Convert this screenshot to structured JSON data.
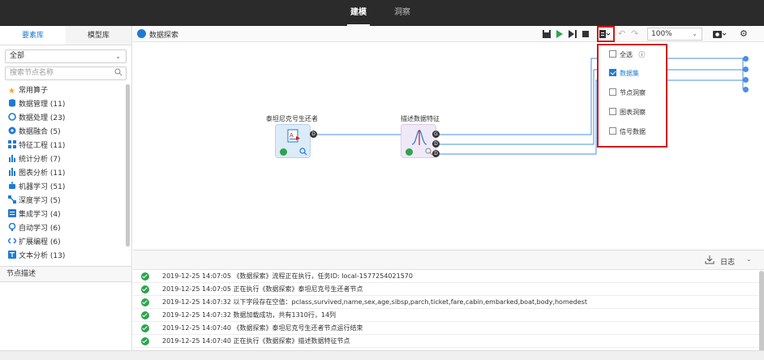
{
  "topbar": {
    "tabs": [
      {
        "label": "建模",
        "active": true
      },
      {
        "label": "洞察",
        "active": false
      }
    ]
  },
  "left": {
    "tabs": [
      {
        "label": "要素库",
        "active": true
      },
      {
        "label": "模型库",
        "active": false
      }
    ],
    "select_value": "全部",
    "search_placeholder": "搜索节点名称",
    "tree": [
      {
        "label": "常用算子",
        "icon": "star-icon",
        "color": "#f5a623"
      },
      {
        "label": "数据管理 (11)",
        "icon": "database-icon",
        "color": "#1f7ad3"
      },
      {
        "label": "数据处理 (23)",
        "icon": "cycle-icon",
        "color": "#1f7ad3"
      },
      {
        "label": "数据融合 (5)",
        "icon": "merge-icon",
        "color": "#1f7ad3"
      },
      {
        "label": "特征工程 (11)",
        "icon": "grid-icon",
        "color": "#1f7ad3"
      },
      {
        "label": "统计分析 (7)",
        "icon": "bar-icon",
        "color": "#1f7ad3"
      },
      {
        "label": "图表分析 (11)",
        "icon": "chart-icon",
        "color": "#1f7ad3"
      },
      {
        "label": "机器学习 (51)",
        "icon": "robot-icon",
        "color": "#1f7ad3"
      },
      {
        "label": "深度学习 (5)",
        "icon": "network-icon",
        "color": "#1f7ad3"
      },
      {
        "label": "集成学习 (4)",
        "icon": "ensemble-icon",
        "color": "#1f7ad3"
      },
      {
        "label": "自动学习 (6)",
        "icon": "auto-icon",
        "color": "#1f7ad3"
      },
      {
        "label": "扩展编程 (6)",
        "icon": "code-icon",
        "color": "#1f7ad3"
      },
      {
        "label": "文本分析 (13)",
        "icon": "text-icon",
        "color": "#1f7ad3"
      }
    ],
    "node_desc": "节点描述"
  },
  "header": {
    "title": "数据探索",
    "zoom": "100%"
  },
  "canvas": {
    "node1_label": "泰坦尼克号生还者",
    "node2_label": "描述数据特征",
    "port_d": "D",
    "port_g": "G"
  },
  "dropdown": {
    "items": [
      {
        "label": "全选",
        "checked": false,
        "info": "ⓘ"
      },
      {
        "label": "数据集",
        "checked": true
      },
      {
        "label": "节点洞察",
        "checked": false
      },
      {
        "label": "图表洞察",
        "checked": false
      },
      {
        "label": "信号数据",
        "checked": false
      }
    ]
  },
  "log": {
    "label": "日志",
    "rows": [
      "2019-12-25 14:07:05 《数据探索》流程正在执行，任务ID: local-1577254021570",
      "2019-12-25 14:07:05 正在执行《数据探索》泰坦尼克号生还者节点",
      "2019-12-25 14:07:32 以下字段存在空值：pclass,survived,name,sex,age,sibsp,parch,ticket,fare,cabin,embarked,boat,body,homedest",
      "2019-12-25 14:07:32 数据加载成功，共有1310行，14列",
      "2019-12-25 14:07:40 《数据探索》泰坦尼克号生还者节点运行结束",
      "2019-12-25 14:07:40 正在执行《数据探索》描述数据特征节点"
    ]
  },
  "colors": {
    "accent": "#1f7ad3",
    "highlight": "#d01a1a",
    "success": "#2da44e",
    "play": "#2da44e"
  }
}
